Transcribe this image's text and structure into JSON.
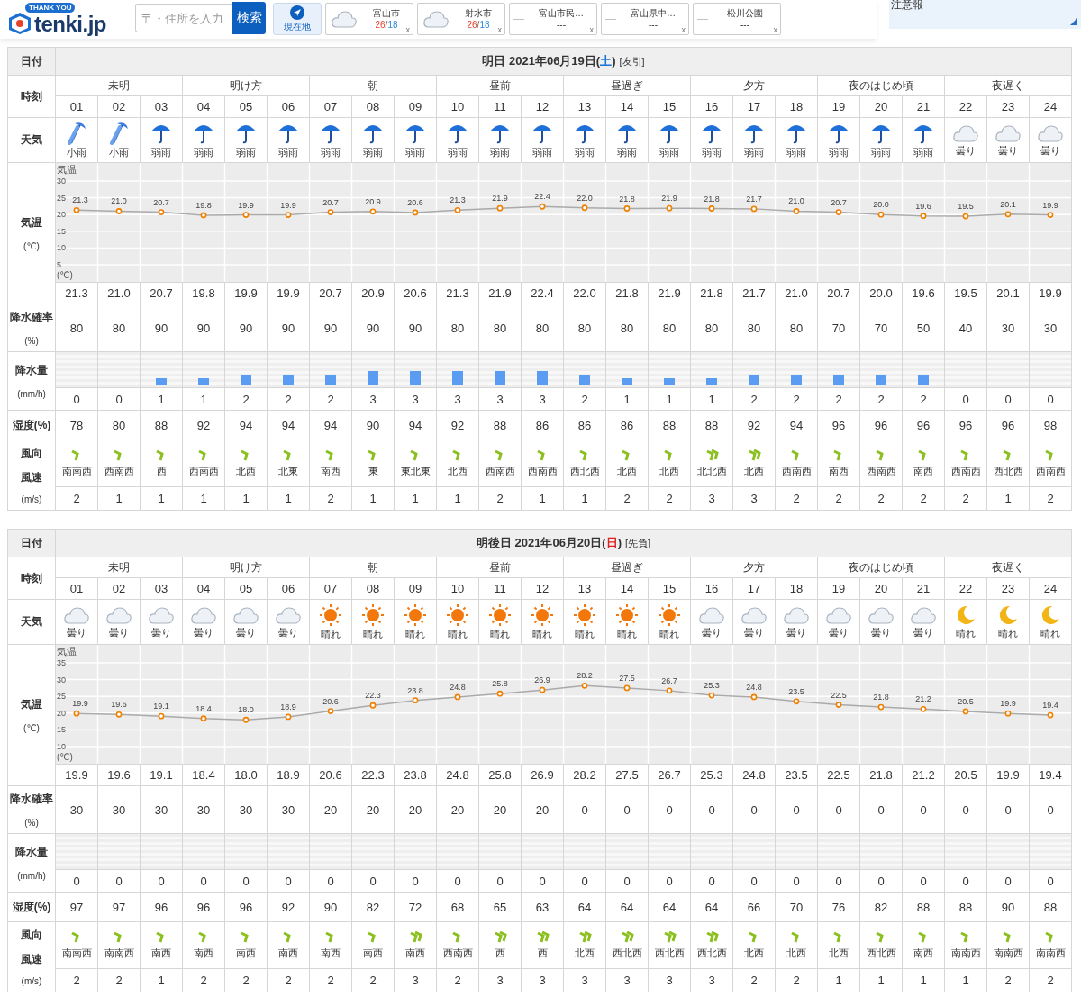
{
  "header": {
    "logo": {
      "badge": "THANK YOU",
      "text": "tenki.jp"
    },
    "search": {
      "placeholder": "〒・住所を入力",
      "button": "検索"
    },
    "locate_button": "現在地",
    "locations": [
      {
        "kind": "weather",
        "name": "富山市",
        "high": "26",
        "sep": "/",
        "low": "18",
        "close": "x"
      },
      {
        "kind": "weather",
        "name": "射水市",
        "high": "26",
        "sep": "/",
        "low": "18",
        "close": "x"
      },
      {
        "kind": "empty",
        "dash": "—",
        "name": "富山市民…",
        "value": "---",
        "close": "x"
      },
      {
        "kind": "empty",
        "dash": "—",
        "name": "富山県中…",
        "value": "---",
        "close": "x"
      },
      {
        "kind": "empty",
        "dash": "—",
        "name": "松川公園",
        "value": "---",
        "close": "x"
      }
    ],
    "alert_panel": "注意報"
  },
  "days": [
    {
      "labels": {
        "date": "日付",
        "time": "時刻",
        "weather": "天気",
        "temp": "気温",
        "temp_unit": "(℃)",
        "prob": "降水確率",
        "prob_unit": "(%)",
        "precip": "降水量",
        "precip_unit": "(mm/h)",
        "humidity": "湿度(%)",
        "wind_dir": "風向",
        "wind_speed": "風速",
        "wind_unit": "(m/s)"
      },
      "date": "明日 2021年06月19日(",
      "weekday": {
        "text": "土",
        "color": "#1a73d9"
      },
      "date_end": ")",
      "rokuyo": "[友引]",
      "periods": [
        "未明",
        "明け方",
        "朝",
        "昼前",
        "昼過ぎ",
        "夕方",
        "夜のはじめ頃",
        "夜遅く"
      ],
      "hours": [
        "01",
        "02",
        "03",
        "04",
        "05",
        "06",
        "07",
        "08",
        "09",
        "10",
        "11",
        "12",
        "13",
        "14",
        "15",
        "16",
        "17",
        "18",
        "19",
        "20",
        "21",
        "22",
        "23",
        "24"
      ],
      "weather": [
        {
          "kind": "light-rain",
          "label": "小雨"
        },
        {
          "kind": "light-rain",
          "label": "小雨"
        },
        {
          "kind": "rain",
          "label": "弱雨"
        },
        {
          "kind": "rain",
          "label": "弱雨"
        },
        {
          "kind": "rain",
          "label": "弱雨"
        },
        {
          "kind": "rain",
          "label": "弱雨"
        },
        {
          "kind": "rain",
          "label": "弱雨"
        },
        {
          "kind": "rain",
          "label": "弱雨"
        },
        {
          "kind": "rain",
          "label": "弱雨"
        },
        {
          "kind": "rain",
          "label": "弱雨"
        },
        {
          "kind": "rain",
          "label": "弱雨"
        },
        {
          "kind": "rain",
          "label": "弱雨"
        },
        {
          "kind": "rain",
          "label": "弱雨"
        },
        {
          "kind": "rain",
          "label": "弱雨"
        },
        {
          "kind": "rain",
          "label": "弱雨"
        },
        {
          "kind": "rain",
          "label": "弱雨"
        },
        {
          "kind": "rain",
          "label": "弱雨"
        },
        {
          "kind": "rain",
          "label": "弱雨"
        },
        {
          "kind": "rain",
          "label": "弱雨"
        },
        {
          "kind": "rain",
          "label": "弱雨"
        },
        {
          "kind": "rain",
          "label": "弱雨"
        },
        {
          "kind": "cloudy",
          "label": "曇り"
        },
        {
          "kind": "cloudy",
          "label": "曇り"
        },
        {
          "kind": "cloudy",
          "label": "曇り"
        }
      ],
      "chart_unit": "(℃)",
      "chart_data": {
        "type": "line",
        "ylabel": "気温",
        "ylim": [
          5,
          30
        ],
        "yticks": [
          5,
          10,
          15,
          20,
          25,
          30
        ],
        "grid": true,
        "value_labels": [
          "21.3",
          "21.0",
          "20.7",
          "19.8",
          "19.9",
          "19.9",
          "20.7",
          "20.9",
          "20.6",
          "21.3",
          "21.9",
          "22.4",
          "22.0",
          "21.8",
          "21.9",
          "21.8",
          "21.7",
          "21.0",
          "20.7",
          "20.0",
          "19.6",
          "19.5",
          "20.1",
          "19.9"
        ],
        "series": [
          {
            "color": "#f08000",
            "marker": "circle",
            "values": [
              21.3,
              21.0,
              20.7,
              19.8,
              19.9,
              19.9,
              20.7,
              20.9,
              20.6,
              21.3,
              21.9,
              22.4,
              22.0,
              21.8,
              21.9,
              21.8,
              21.7,
              21.0,
              20.7,
              20.0,
              19.6,
              19.5,
              20.1,
              19.9
            ]
          }
        ]
      },
      "temps": [
        "21.3",
        "21.0",
        "20.7",
        "19.8",
        "19.9",
        "19.9",
        "20.7",
        "20.9",
        "20.6",
        "21.3",
        "21.9",
        "22.4",
        "22.0",
        "21.8",
        "21.9",
        "21.8",
        "21.7",
        "21.0",
        "20.7",
        "20.0",
        "19.6",
        "19.5",
        "20.1",
        "19.9"
      ],
      "prob": [
        "80",
        "80",
        "90",
        "90",
        "90",
        "90",
        "90",
        "90",
        "90",
        "80",
        "80",
        "80",
        "80",
        "80",
        "80",
        "80",
        "80",
        "80",
        "70",
        "70",
        "50",
        "40",
        "30",
        "30"
      ],
      "precip": [
        "0",
        "0",
        "1",
        "1",
        "2",
        "2",
        "2",
        "3",
        "3",
        "3",
        "3",
        "3",
        "2",
        "1",
        "1",
        "1",
        "2",
        "2",
        "2",
        "2",
        "2",
        "0",
        "0",
        "0"
      ],
      "humidity": [
        "78",
        "80",
        "88",
        "92",
        "94",
        "94",
        "94",
        "90",
        "94",
        "92",
        "88",
        "86",
        "86",
        "86",
        "88",
        "88",
        "92",
        "94",
        "96",
        "96",
        "96",
        "96",
        "96",
        "98"
      ],
      "wind_dir": [
        "南南西",
        "西南西",
        "西",
        "西南西",
        "北西",
        "北東",
        "南西",
        "東",
        "東北東",
        "北西",
        "西南西",
        "西南西",
        "西北西",
        "北西",
        "北西",
        "北北西",
        "北西",
        "西南西",
        "南西",
        "西南西",
        "南西",
        "西南西",
        "西北西",
        "西南西"
      ],
      "wind_speed": [
        "2",
        "1",
        "1",
        "1",
        "1",
        "1",
        "2",
        "1",
        "1",
        "1",
        "2",
        "1",
        "1",
        "2",
        "2",
        "3",
        "3",
        "2",
        "2",
        "2",
        "2",
        "2",
        "1",
        "2"
      ]
    },
    {
      "labels": {
        "date": "日付",
        "time": "時刻",
        "weather": "天気",
        "temp": "気温",
        "temp_unit": "(℃)",
        "prob": "降水確率",
        "prob_unit": "(%)",
        "precip": "降水量",
        "precip_unit": "(mm/h)",
        "humidity": "湿度(%)",
        "wind_dir": "風向",
        "wind_speed": "風速",
        "wind_unit": "(m/s)"
      },
      "date": "明後日 2021年06月20日(",
      "weekday": {
        "text": "日",
        "color": "#e0201c"
      },
      "date_end": ")",
      "rokuyo": "[先負]",
      "periods": [
        "未明",
        "明け方",
        "朝",
        "昼前",
        "昼過ぎ",
        "夕方",
        "夜のはじめ頃",
        "夜遅く"
      ],
      "hours": [
        "01",
        "02",
        "03",
        "04",
        "05",
        "06",
        "07",
        "08",
        "09",
        "10",
        "11",
        "12",
        "13",
        "14",
        "15",
        "16",
        "17",
        "18",
        "19",
        "20",
        "21",
        "22",
        "23",
        "24"
      ],
      "weather": [
        {
          "kind": "cloudy",
          "label": "曇り"
        },
        {
          "kind": "cloudy",
          "label": "曇り"
        },
        {
          "kind": "cloudy",
          "label": "曇り"
        },
        {
          "kind": "cloudy",
          "label": "曇り"
        },
        {
          "kind": "cloudy",
          "label": "曇り"
        },
        {
          "kind": "cloudy",
          "label": "曇り"
        },
        {
          "kind": "sunny",
          "label": "晴れ"
        },
        {
          "kind": "sunny",
          "label": "晴れ"
        },
        {
          "kind": "sunny",
          "label": "晴れ"
        },
        {
          "kind": "sunny",
          "label": "晴れ"
        },
        {
          "kind": "sunny",
          "label": "晴れ"
        },
        {
          "kind": "sunny",
          "label": "晴れ"
        },
        {
          "kind": "sunny",
          "label": "晴れ"
        },
        {
          "kind": "sunny",
          "label": "晴れ"
        },
        {
          "kind": "sunny",
          "label": "晴れ"
        },
        {
          "kind": "cloudy",
          "label": "曇り"
        },
        {
          "kind": "cloudy",
          "label": "曇り"
        },
        {
          "kind": "cloudy",
          "label": "曇り"
        },
        {
          "kind": "cloudy",
          "label": "曇り"
        },
        {
          "kind": "cloudy",
          "label": "曇り"
        },
        {
          "kind": "cloudy",
          "label": "曇り"
        },
        {
          "kind": "moon",
          "label": "晴れ"
        },
        {
          "kind": "moon",
          "label": "晴れ"
        },
        {
          "kind": "moon",
          "label": "晴れ"
        }
      ],
      "chart_unit": "(℃)",
      "chart_data": {
        "type": "line",
        "ylabel": "気温",
        "ylim": [
          10,
          35
        ],
        "yticks": [
          10,
          15,
          20,
          25,
          30,
          35
        ],
        "grid": true,
        "value_labels": [
          "19.9",
          "19.6",
          "19.1",
          "18.4",
          "18.0",
          "18.9",
          "20.6",
          "22.3",
          "23.8",
          "24.8",
          "25.8",
          "26.9",
          "28.2",
          "27.5",
          "26.7",
          "25.3",
          "24.8",
          "23.5",
          "22.5",
          "21.8",
          "21.2",
          "20.5",
          "19.9",
          "19.4"
        ],
        "series": [
          {
            "color": "#f08000",
            "marker": "circle",
            "values": [
              19.9,
              19.6,
              19.1,
              18.4,
              18.0,
              18.9,
              20.6,
              22.3,
              23.8,
              24.8,
              25.8,
              26.9,
              28.2,
              27.5,
              26.7,
              25.3,
              24.8,
              23.5,
              22.5,
              21.8,
              21.2,
              20.5,
              19.9,
              19.4
            ]
          }
        ]
      },
      "temps": [
        "19.9",
        "19.6",
        "19.1",
        "18.4",
        "18.0",
        "18.9",
        "20.6",
        "22.3",
        "23.8",
        "24.8",
        "25.8",
        "26.9",
        "28.2",
        "27.5",
        "26.7",
        "25.3",
        "24.8",
        "23.5",
        "22.5",
        "21.8",
        "21.2",
        "20.5",
        "19.9",
        "19.4"
      ],
      "prob": [
        "30",
        "30",
        "30",
        "30",
        "30",
        "30",
        "20",
        "20",
        "20",
        "20",
        "20",
        "20",
        "0",
        "0",
        "0",
        "0",
        "0",
        "0",
        "0",
        "0",
        "0",
        "0",
        "0",
        "0"
      ],
      "precip": [
        "0",
        "0",
        "0",
        "0",
        "0",
        "0",
        "0",
        "0",
        "0",
        "0",
        "0",
        "0",
        "0",
        "0",
        "0",
        "0",
        "0",
        "0",
        "0",
        "0",
        "0",
        "0",
        "0",
        "0"
      ],
      "humidity": [
        "97",
        "97",
        "96",
        "96",
        "96",
        "92",
        "90",
        "82",
        "72",
        "68",
        "65",
        "63",
        "64",
        "64",
        "64",
        "64",
        "66",
        "70",
        "76",
        "82",
        "88",
        "88",
        "90",
        "88"
      ],
      "wind_dir": [
        "南南西",
        "南南西",
        "南西",
        "南西",
        "南西",
        "南西",
        "南西",
        "南西",
        "南西",
        "西南西",
        "西",
        "西",
        "北西",
        "西北西",
        "西北西",
        "西北西",
        "北西",
        "北西",
        "北西",
        "西北西",
        "南西",
        "南南西",
        "南南西",
        "南南西"
      ],
      "wind_speed": [
        "2",
        "2",
        "1",
        "2",
        "2",
        "2",
        "2",
        "2",
        "3",
        "2",
        "3",
        "3",
        "3",
        "3",
        "3",
        "3",
        "2",
        "2",
        "1",
        "1",
        "1",
        "1",
        "2",
        "2"
      ]
    }
  ]
}
